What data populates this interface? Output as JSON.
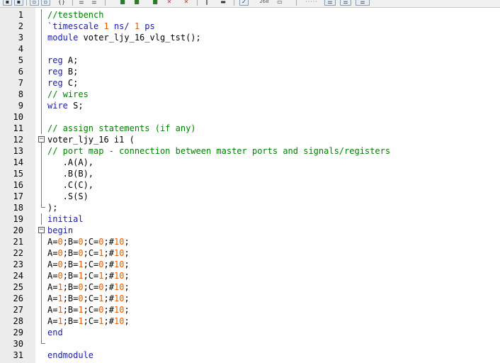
{
  "toolbar": {
    "zoom_label": "268",
    "dots_label": "·····"
  },
  "colors": {
    "keyword": "#1a1aa6",
    "comment": "#008000",
    "number": "#e55b00",
    "text": "#000000",
    "gutter_bg": "#ececec"
  },
  "lines": [
    {
      "n": "1",
      "fold": "bar",
      "tokens": [
        {
          "t": "//testbench",
          "c": "cm"
        }
      ]
    },
    {
      "n": "2",
      "fold": "bar",
      "tokens": [
        {
          "t": "`timescale ",
          "c": "kw"
        },
        {
          "t": "1",
          "c": "nm"
        },
        {
          "t": " ns/ ",
          "c": "kw"
        },
        {
          "t": "1",
          "c": "nm"
        },
        {
          "t": " ps",
          "c": "kw"
        }
      ]
    },
    {
      "n": "3",
      "fold": "bar",
      "tokens": [
        {
          "t": "module",
          "c": "kw"
        },
        {
          "t": " voter_ljy_16_vlg_tst();",
          "c": "tx"
        }
      ]
    },
    {
      "n": "4",
      "fold": "bar",
      "tokens": []
    },
    {
      "n": "5",
      "fold": "bar",
      "tokens": [
        {
          "t": "reg",
          "c": "kw"
        },
        {
          "t": " A;",
          "c": "tx"
        }
      ]
    },
    {
      "n": "6",
      "fold": "bar",
      "tokens": [
        {
          "t": "reg",
          "c": "kw"
        },
        {
          "t": " B;",
          "c": "tx"
        }
      ]
    },
    {
      "n": "7",
      "fold": "bar",
      "tokens": [
        {
          "t": "reg",
          "c": "kw"
        },
        {
          "t": " C;",
          "c": "tx"
        }
      ]
    },
    {
      "n": "8",
      "fold": "bar",
      "tokens": [
        {
          "t": "// wires",
          "c": "cm"
        }
      ]
    },
    {
      "n": "9",
      "fold": "bar",
      "tokens": [
        {
          "t": "wire",
          "c": "kw"
        },
        {
          "t": " S;",
          "c": "tx"
        }
      ]
    },
    {
      "n": "10",
      "fold": "bar",
      "tokens": []
    },
    {
      "n": "11",
      "fold": "bar",
      "tokens": [
        {
          "t": "// assign statements (if any)",
          "c": "cm"
        }
      ]
    },
    {
      "n": "12",
      "fold": "box",
      "tokens": [
        {
          "t": "voter_ljy_16 i1 (",
          "c": "tx"
        }
      ]
    },
    {
      "n": "13",
      "fold": "bar",
      "tokens": [
        {
          "t": "// port map - connection between master ports and signals/registers",
          "c": "cm"
        }
      ]
    },
    {
      "n": "14",
      "fold": "bar",
      "tokens": [
        {
          "t": "   .A(A),",
          "c": "tx"
        }
      ]
    },
    {
      "n": "15",
      "fold": "bar",
      "tokens": [
        {
          "t": "   .B(B),",
          "c": "tx"
        }
      ]
    },
    {
      "n": "16",
      "fold": "bar",
      "tokens": [
        {
          "t": "   .C(C),",
          "c": "tx"
        }
      ]
    },
    {
      "n": "17",
      "fold": "bar",
      "tokens": [
        {
          "t": "   .S(S)",
          "c": "tx"
        }
      ]
    },
    {
      "n": "18",
      "fold": "end",
      "tokens": [
        {
          "t": ");",
          "c": "tx"
        }
      ]
    },
    {
      "n": "19",
      "fold": "bar",
      "tokens": [
        {
          "t": "initial",
          "c": "kw"
        }
      ]
    },
    {
      "n": "20",
      "fold": "box",
      "tokens": [
        {
          "t": "begin",
          "c": "kw"
        }
      ]
    },
    {
      "n": "21",
      "fold": "bar",
      "tokens": [
        {
          "t": "A=",
          "c": "tx"
        },
        {
          "t": "0",
          "c": "nm"
        },
        {
          "t": ";B=",
          "c": "tx"
        },
        {
          "t": "0",
          "c": "nm"
        },
        {
          "t": ";C=",
          "c": "tx"
        },
        {
          "t": "0",
          "c": "nm"
        },
        {
          "t": ";#",
          "c": "tx"
        },
        {
          "t": "10",
          "c": "nm"
        },
        {
          "t": ";",
          "c": "tx"
        }
      ]
    },
    {
      "n": "22",
      "fold": "bar",
      "tokens": [
        {
          "t": "A=",
          "c": "tx"
        },
        {
          "t": "0",
          "c": "nm"
        },
        {
          "t": ";B=",
          "c": "tx"
        },
        {
          "t": "0",
          "c": "nm"
        },
        {
          "t": ";C=",
          "c": "tx"
        },
        {
          "t": "1",
          "c": "nm"
        },
        {
          "t": ";#",
          "c": "tx"
        },
        {
          "t": "10",
          "c": "nm"
        },
        {
          "t": ";",
          "c": "tx"
        }
      ]
    },
    {
      "n": "23",
      "fold": "bar",
      "tokens": [
        {
          "t": "A=",
          "c": "tx"
        },
        {
          "t": "0",
          "c": "nm"
        },
        {
          "t": ";B=",
          "c": "tx"
        },
        {
          "t": "1",
          "c": "nm"
        },
        {
          "t": ";C=",
          "c": "tx"
        },
        {
          "t": "0",
          "c": "nm"
        },
        {
          "t": ";#",
          "c": "tx"
        },
        {
          "t": "10",
          "c": "nm"
        },
        {
          "t": ";",
          "c": "tx"
        }
      ]
    },
    {
      "n": "24",
      "fold": "bar",
      "tokens": [
        {
          "t": "A=",
          "c": "tx"
        },
        {
          "t": "0",
          "c": "nm"
        },
        {
          "t": ";B=",
          "c": "tx"
        },
        {
          "t": "1",
          "c": "nm"
        },
        {
          "t": ";C=",
          "c": "tx"
        },
        {
          "t": "1",
          "c": "nm"
        },
        {
          "t": ";#",
          "c": "tx"
        },
        {
          "t": "10",
          "c": "nm"
        },
        {
          "t": ";",
          "c": "tx"
        }
      ]
    },
    {
      "n": "25",
      "fold": "bar",
      "tokens": [
        {
          "t": "A=",
          "c": "tx"
        },
        {
          "t": "1",
          "c": "nm"
        },
        {
          "t": ";B=",
          "c": "tx"
        },
        {
          "t": "0",
          "c": "nm"
        },
        {
          "t": ";C=",
          "c": "tx"
        },
        {
          "t": "0",
          "c": "nm"
        },
        {
          "t": ";#",
          "c": "tx"
        },
        {
          "t": "10",
          "c": "nm"
        },
        {
          "t": ";",
          "c": "tx"
        }
      ]
    },
    {
      "n": "26",
      "fold": "bar",
      "tokens": [
        {
          "t": "A=",
          "c": "tx"
        },
        {
          "t": "1",
          "c": "nm"
        },
        {
          "t": ";B=",
          "c": "tx"
        },
        {
          "t": "0",
          "c": "nm"
        },
        {
          "t": ";C=",
          "c": "tx"
        },
        {
          "t": "1",
          "c": "nm"
        },
        {
          "t": ";#",
          "c": "tx"
        },
        {
          "t": "10",
          "c": "nm"
        },
        {
          "t": ";",
          "c": "tx"
        }
      ]
    },
    {
      "n": "27",
      "fold": "bar",
      "tokens": [
        {
          "t": "A=",
          "c": "tx"
        },
        {
          "t": "1",
          "c": "nm"
        },
        {
          "t": ";B=",
          "c": "tx"
        },
        {
          "t": "1",
          "c": "nm"
        },
        {
          "t": ";C=",
          "c": "tx"
        },
        {
          "t": "0",
          "c": "nm"
        },
        {
          "t": ";#",
          "c": "tx"
        },
        {
          "t": "10",
          "c": "nm"
        },
        {
          "t": ";",
          "c": "tx"
        }
      ]
    },
    {
      "n": "28",
      "fold": "bar",
      "tokens": [
        {
          "t": "A=",
          "c": "tx"
        },
        {
          "t": "1",
          "c": "nm"
        },
        {
          "t": ";B=",
          "c": "tx"
        },
        {
          "t": "1",
          "c": "nm"
        },
        {
          "t": ";C=",
          "c": "tx"
        },
        {
          "t": "1",
          "c": "nm"
        },
        {
          "t": ";#",
          "c": "tx"
        },
        {
          "t": "10",
          "c": "nm"
        },
        {
          "t": ";",
          "c": "tx"
        }
      ]
    },
    {
      "n": "29",
      "fold": "bar",
      "tokens": [
        {
          "t": "end",
          "c": "kw"
        }
      ]
    },
    {
      "n": "30",
      "fold": "end",
      "tokens": []
    },
    {
      "n": "31",
      "fold": "none",
      "tokens": [
        {
          "t": "endmodule",
          "c": "kw"
        }
      ]
    }
  ]
}
